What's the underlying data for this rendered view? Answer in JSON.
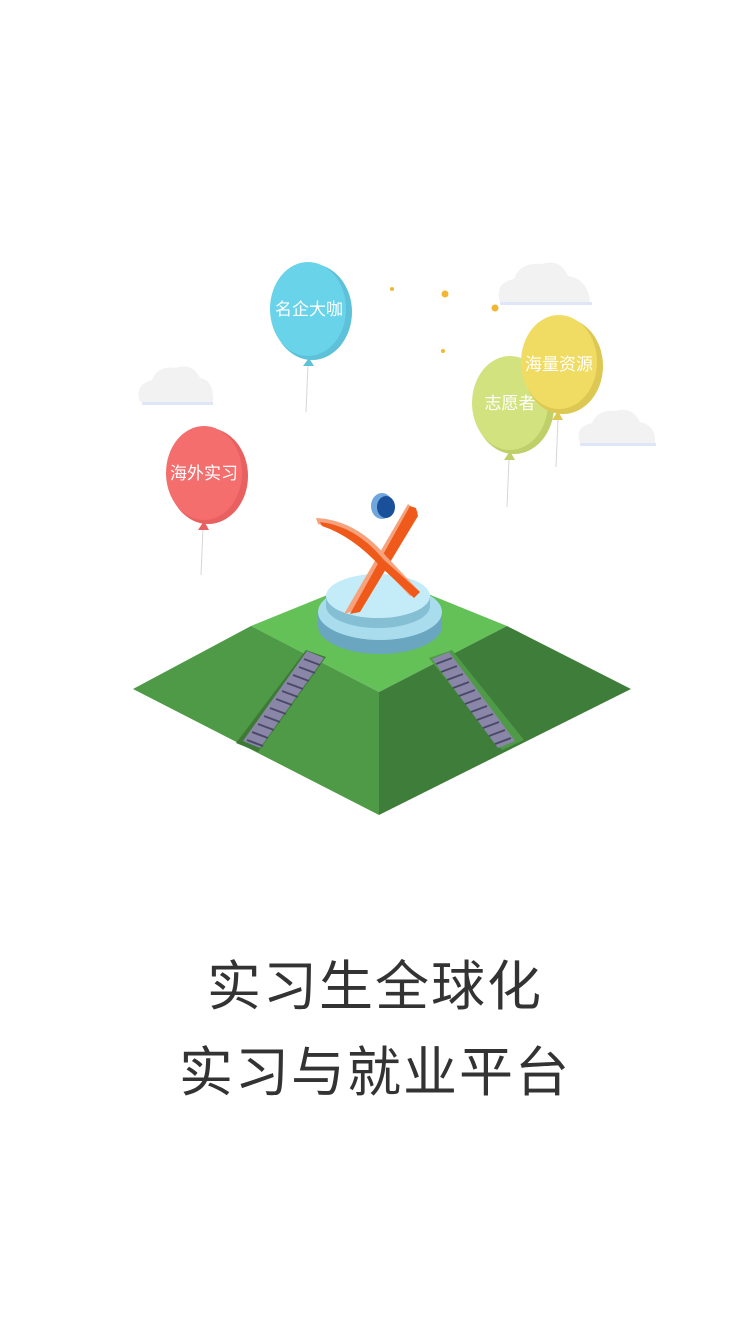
{
  "balloons": {
    "overseas_internship": "海外实习",
    "famous_companies": "名企大咖",
    "volunteer": "志愿者",
    "massive_resources": "海量资源"
  },
  "tagline": {
    "line1": "实习生全球化",
    "line2": "实习与就业平台"
  },
  "colors": {
    "balloon_red": "#f46e6e",
    "balloon_blue": "#69d3ea",
    "balloon_green": "#d2e27f",
    "balloon_yellow": "#f1dc63",
    "grass_top": "#64c157",
    "grass_left": "#4e9a46",
    "grass_right": "#3f7e3a",
    "logo_orange": "#ef5a1b",
    "logo_blue": "#1a5aa6",
    "text": "#333333"
  }
}
